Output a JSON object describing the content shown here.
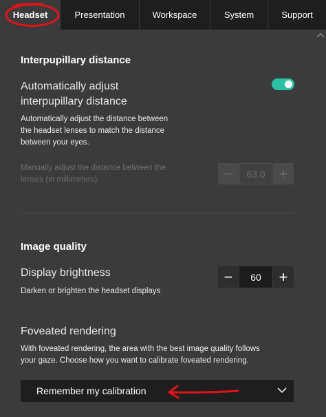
{
  "tabs": [
    {
      "label": "Headset",
      "active": true
    },
    {
      "label": "Presentation",
      "active": false
    },
    {
      "label": "Workspace",
      "active": false
    },
    {
      "label": "System",
      "active": false
    },
    {
      "label": "Support",
      "active": false
    }
  ],
  "ipd": {
    "section_title": "Interpupillary distance",
    "auto_label_line1": "Automatically adjust",
    "auto_label_line2": "interpupillary distance",
    "auto_desc_line1": "Automatically adjust the distance between",
    "auto_desc_line2": "the headset lenses to match the distance",
    "auto_desc_line3": "between your eyes.",
    "auto_enabled": true,
    "manual_desc_line1": "Manually adjust the distance between the",
    "manual_desc_line2": "lenses (in millimeters).",
    "manual_value": "63.0"
  },
  "image_quality": {
    "section_title": "Image quality",
    "brightness_label": "Display brightness",
    "brightness_desc": "Darken or brighten the headset displays",
    "brightness_value": "60",
    "foveated_label": "Foveated rendering",
    "foveated_desc_line1": "With foveated rendering, the area with the best image quality follows",
    "foveated_desc_line2": "your gaze. Choose how you want to calibrate foveated rendering.",
    "calibration_selected": "Remember my calibration"
  },
  "stepper_symbols": {
    "minus": "−",
    "plus": "+"
  },
  "colors": {
    "accent": "#2bc1a3",
    "annotation": "#e0131b",
    "tabbar": "#1e1e1e",
    "panel": "#3b3b3b"
  }
}
